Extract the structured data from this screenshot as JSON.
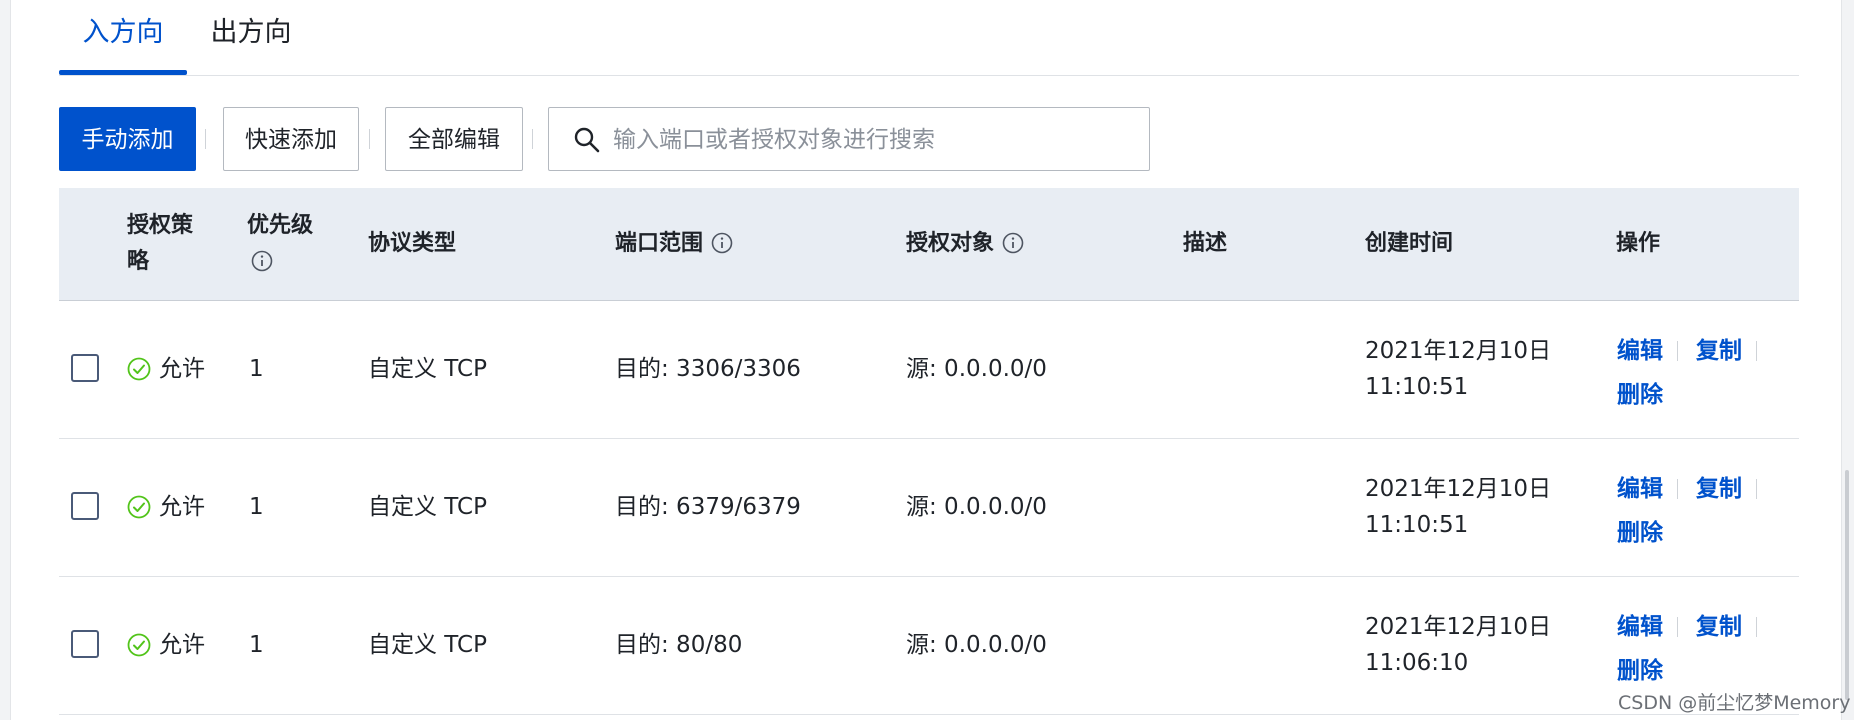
{
  "tabs": [
    {
      "label": "入方向",
      "active": true
    },
    {
      "label": "出方向",
      "active": false
    }
  ],
  "toolbar": {
    "manual_add": "手动添加",
    "quick_add": "快速添加",
    "edit_all": "全部编辑",
    "search_placeholder": "输入端口或者授权对象进行搜索",
    "search_value": ""
  },
  "table": {
    "headers": {
      "policy_line1": "授权策",
      "policy_line2": "略",
      "priority": "优先级",
      "protocol": "协议类型",
      "port_range": "端口范围",
      "auth_object": "授权对象",
      "description": "描述",
      "created": "创建时间",
      "actions": "操作"
    },
    "rows": [
      {
        "policy": "允许",
        "priority": "1",
        "protocol": "自定义 TCP",
        "port_range": "目的: 3306/3306",
        "auth_object": "源: 0.0.0.0/0",
        "description": "",
        "created_date": "2021年12月10日",
        "created_time": "11:10:51",
        "edit": "编辑",
        "copy": "复制",
        "delete": "删除"
      },
      {
        "policy": "允许",
        "priority": "1",
        "protocol": "自定义 TCP",
        "port_range": "目的: 6379/6379",
        "auth_object": "源: 0.0.0.0/0",
        "description": "",
        "created_date": "2021年12月10日",
        "created_time": "11:10:51",
        "edit": "编辑",
        "copy": "复制",
        "delete": "删除"
      },
      {
        "policy": "允许",
        "priority": "1",
        "protocol": "自定义 TCP",
        "port_range": "目的: 80/80",
        "auth_object": "源: 0.0.0.0/0",
        "description": "",
        "created_date": "2021年12月10日",
        "created_time": "11:06:10",
        "edit": "编辑",
        "copy": "复制",
        "delete": "删除"
      }
    ]
  },
  "watermark": "CSDN @前尘忆梦Memory",
  "colors": {
    "accent": "#0052cc",
    "success": "#52c41a",
    "header_bg": "#e8edf3"
  }
}
